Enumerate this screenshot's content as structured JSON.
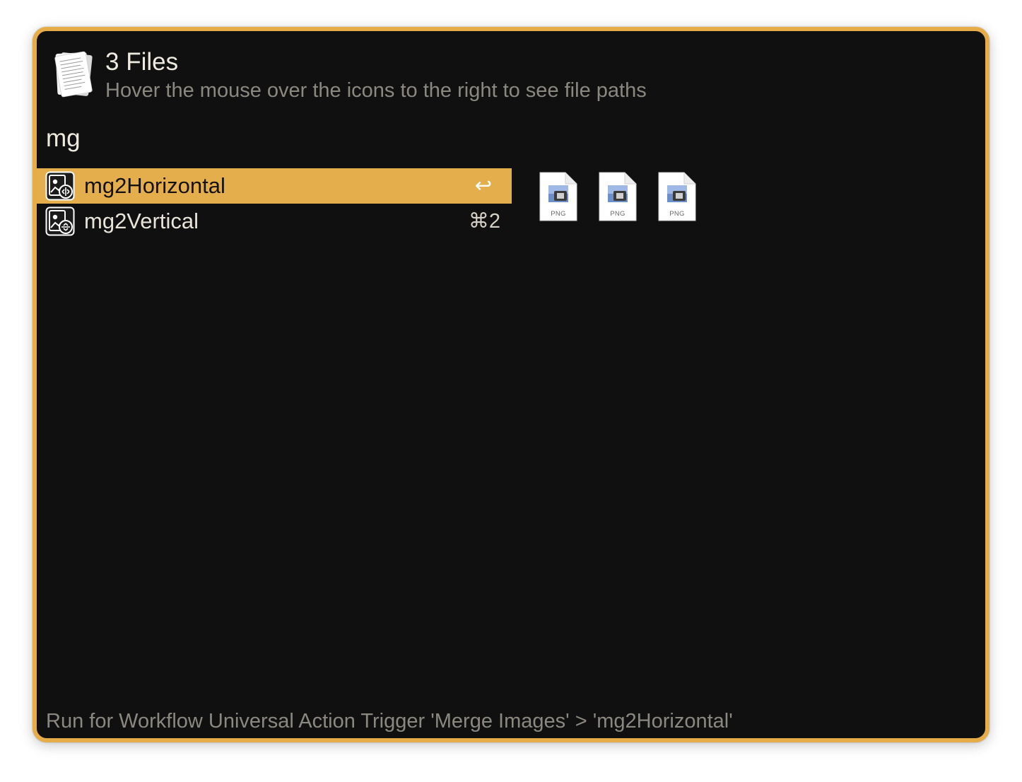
{
  "header": {
    "title": "3 Files",
    "subtitle": "Hover the mouse over the icons to the right to see file paths",
    "icon": "documents-stack-icon"
  },
  "search": {
    "query": "mg"
  },
  "results": [
    {
      "label": "mg2Horizontal",
      "shortcut": "↩",
      "selected": true,
      "icon": "merge-images-horizontal-icon"
    },
    {
      "label": "mg2Vertical",
      "shortcut": "⌘2",
      "selected": false,
      "icon": "merge-images-vertical-icon"
    }
  ],
  "files": [
    {
      "type": "PNG",
      "icon": "png-file-icon"
    },
    {
      "type": "PNG",
      "icon": "png-file-icon"
    },
    {
      "type": "PNG",
      "icon": "png-file-icon"
    }
  ],
  "footer": {
    "text": "Run for Workflow Universal Action Trigger 'Merge Images' > 'mg2Horizontal'"
  },
  "colors": {
    "accent": "#e5ae4d",
    "background": "#111010",
    "border": "#e5ac48",
    "text_primary": "#efeadf",
    "text_secondary": "#8b8880"
  }
}
